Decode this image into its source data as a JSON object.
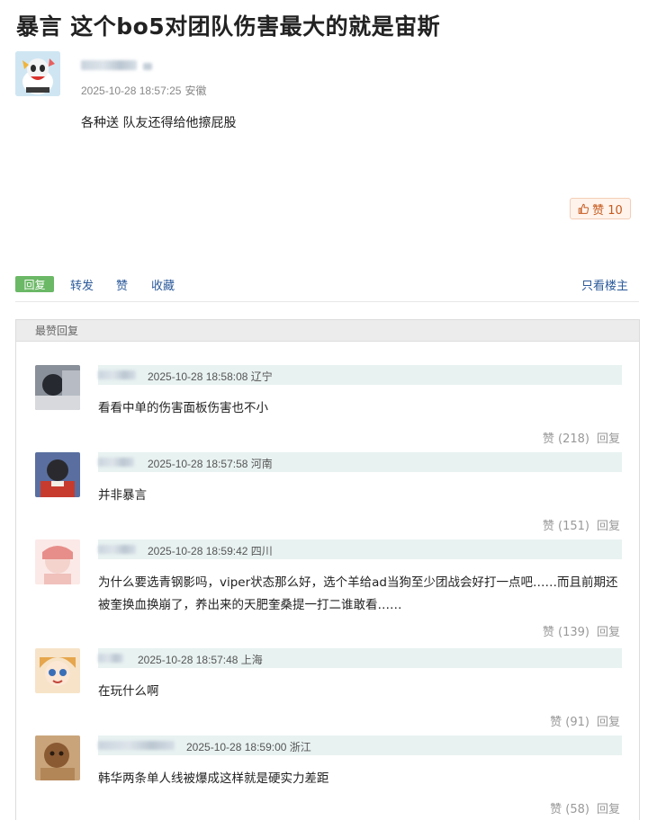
{
  "post": {
    "title": "暴言 这个bo5对团队伤害最大的就是宙斯",
    "time": "2025-10-28 18:57:25",
    "location": "安徽",
    "content": "各种送 队友还得给他擦屁股",
    "like_label": "赞 10"
  },
  "actions": {
    "reply": "回复",
    "forward": "转发",
    "like": "赞",
    "favorite": "收藏",
    "only_op": "只看楼主"
  },
  "hot_replies": {
    "header": "最赞回复",
    "items": [
      {
        "time": "2025-10-28 18:58:08",
        "location": "辽宁",
        "text": "看看中单的伤害面板伤害也不小",
        "likes": "赞 (218)",
        "reply": "回复",
        "avatar_color": "#3b3f47"
      },
      {
        "time": "2025-10-28 18:57:58",
        "location": "河南",
        "text": "并非暴言",
        "likes": "赞 (151)",
        "reply": "回复",
        "avatar_color": "#b33228"
      },
      {
        "time": "2025-10-28 18:59:42",
        "location": "四川",
        "text": "为什么要选青钢影吗，viper状态那么好，选个羊给ad当狗至少团战会好打一点吧……而且前期还被奎换血换崩了，养出来的天肥奎桑提一打二谁敢看……",
        "likes": "赞 (139)",
        "reply": "回复",
        "avatar_color": "#f1c9c4"
      },
      {
        "time": "2025-10-28 18:57:48",
        "location": "上海",
        "text": "在玩什么啊",
        "likes": "赞 (91)",
        "reply": "回复",
        "avatar_color": "#e7b98f"
      },
      {
        "time": "2025-10-28 18:59:00",
        "location": "浙江",
        "text": "韩华两条单人线被爆成这样就是硬实力差距",
        "likes": "赞 (58)",
        "reply": "回复",
        "avatar_color": "#a87a4e"
      }
    ]
  },
  "icons": {
    "like": "thumbs-up-icon"
  }
}
